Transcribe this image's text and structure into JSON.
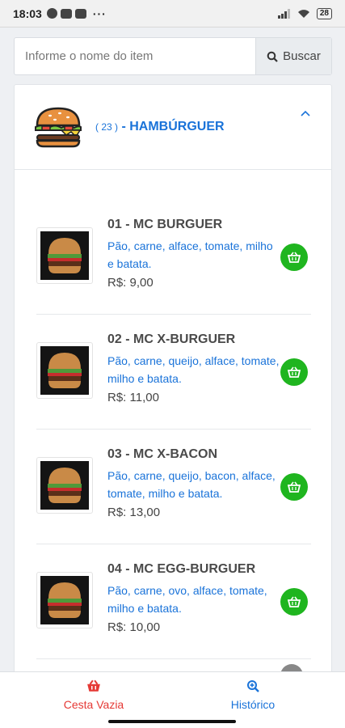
{
  "status_bar": {
    "time": "18:03",
    "battery": "28"
  },
  "search": {
    "placeholder": "Informe o nome do item",
    "button_label": "Buscar"
  },
  "category": {
    "count": "( 23 )",
    "name": "- HAMBÚRGUER"
  },
  "items": [
    {
      "name": "01 - MC BURGUER",
      "description": "Pão, carne, alface, tomate, milho e batata.",
      "price": "R$: 9,00"
    },
    {
      "name": "02 - MC X-BURGUER",
      "description": "Pão, carne, queijo, alface, tomate, milho e batata.",
      "price": "R$: 11,00"
    },
    {
      "name": "03 - MC X-BACON",
      "description": "Pão, carne, queijo, bacon, alface, tomate, milho e batata.",
      "price": "R$: 13,00"
    },
    {
      "name": "04 - MC EGG-BURGUER",
      "description": "Pão, carne, ovo, alface, tomate, milho e batata.",
      "price": "R$: 10,00"
    }
  ],
  "bottom_nav": {
    "basket_label": "Cesta Vazia",
    "history_label": "Histórico"
  },
  "colors": {
    "accent": "#1a73d9",
    "add_button": "#1fb51f",
    "basket": "#e53935"
  }
}
